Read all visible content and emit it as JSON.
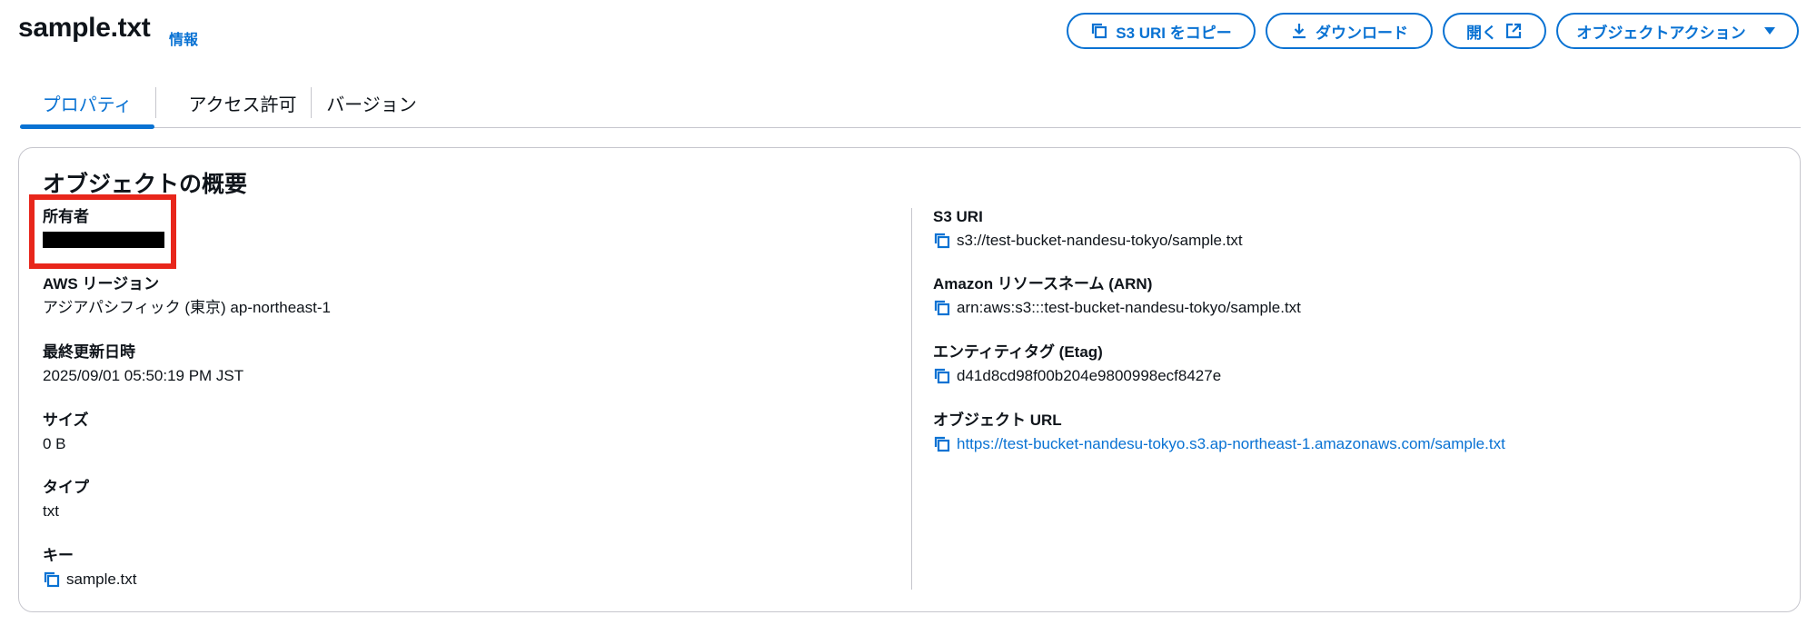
{
  "header": {
    "title": "sample.txt",
    "info_link": "情報",
    "buttons": {
      "copy_uri": "S3 URI をコピー",
      "download": "ダウンロード",
      "open": "開く",
      "object_actions": "オブジェクトアクション"
    }
  },
  "tabs": [
    {
      "label": "プロパティ",
      "active": true
    },
    {
      "label": "アクセス許可",
      "active": false
    },
    {
      "label": "バージョン",
      "active": false
    }
  ],
  "overview": {
    "title": "オブジェクトの概要",
    "left": {
      "owner": {
        "label": "所有者"
      },
      "region": {
        "label": "AWS リージョン",
        "value": "アジアパシフィック (東京) ap-northeast-1"
      },
      "last_modified": {
        "label": "最終更新日時",
        "value": "2025/09/01 05:50:19 PM JST"
      },
      "size": {
        "label": "サイズ",
        "value": "0 B"
      },
      "type": {
        "label": "タイプ",
        "value": "txt"
      },
      "key": {
        "label": "キー",
        "value": "sample.txt"
      }
    },
    "right": {
      "s3_uri": {
        "label": "S3 URI",
        "value": "s3://test-bucket-nandesu-tokyo/sample.txt"
      },
      "arn": {
        "label": "Amazon リソースネーム (ARN)",
        "value": "arn:aws:s3:::test-bucket-nandesu-tokyo/sample.txt"
      },
      "etag": {
        "label": "エンティティタグ (Etag)",
        "value": "d41d8cd98f00b204e9800998ecf8427e"
      },
      "object_url": {
        "label": "オブジェクト URL",
        "value": "https://test-bucket-nandesu-tokyo.s3.ap-northeast-1.amazonaws.com/sample.txt"
      }
    }
  },
  "colors": {
    "accent": "#0972d3",
    "highlight": "#e8261b",
    "text": "#0f141a",
    "border": "#c6c6cd"
  },
  "icons": [
    "copy-icon",
    "download-icon",
    "external-link-icon",
    "caret-down-icon"
  ]
}
